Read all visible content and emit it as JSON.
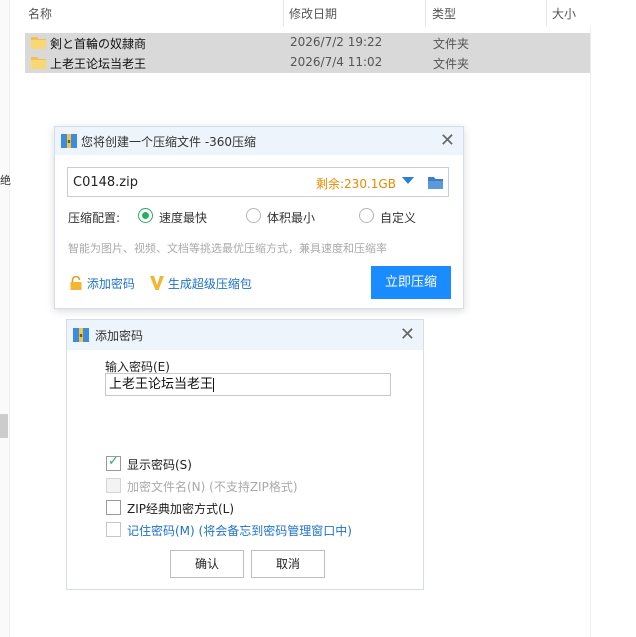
{
  "explorer": {
    "columns": {
      "name": "名称",
      "modified": "修改日期",
      "type": "类型",
      "size": "大小"
    },
    "left_char": "绝",
    "files": [
      {
        "name": "剣と首輪の奴隷商",
        "modified": "2026/7/2 19:22",
        "type": "文件夹"
      },
      {
        "name": "上老王论坛当老王",
        "modified": "2026/7/4 11:02",
        "type": "文件夹"
      }
    ]
  },
  "compress_dialog": {
    "title": "您将创建一个压缩文件 -360压缩",
    "filename": "C0148.zip",
    "remaining": "剩余:230.1GB",
    "config_label": "压缩配置:",
    "options": [
      {
        "label": "速度最快",
        "selected": true
      },
      {
        "label": "体积最小",
        "selected": false
      },
      {
        "label": "自定义",
        "selected": false
      }
    ],
    "hint": "智能为图片、视频、文档等挑选最优压缩方式，兼具速度和压缩率",
    "add_password": "添加密码",
    "super_compress": "生成超级压缩包",
    "compress_button": "立即压缩",
    "colors": {
      "accent": "#1a8cff",
      "remaining": "#e68a00",
      "radio": "#27ae60"
    }
  },
  "password_dialog": {
    "title": "添加密码",
    "input_label": "输入密码(E)",
    "password_value": "上老王论坛当老王",
    "checkboxes": [
      {
        "label": "显示密码(S)",
        "checked": true,
        "disabled": false
      },
      {
        "label": "加密文件名(N) (不支持ZIP格式)",
        "checked": false,
        "disabled": true
      },
      {
        "label": "ZIP经典加密方式(L)",
        "checked": false,
        "disabled": false
      },
      {
        "label": "记住密码(M) (将会备忘到密码管理窗口中)",
        "checked": false,
        "disabled": false
      }
    ],
    "ok": "确认",
    "cancel": "取消"
  }
}
